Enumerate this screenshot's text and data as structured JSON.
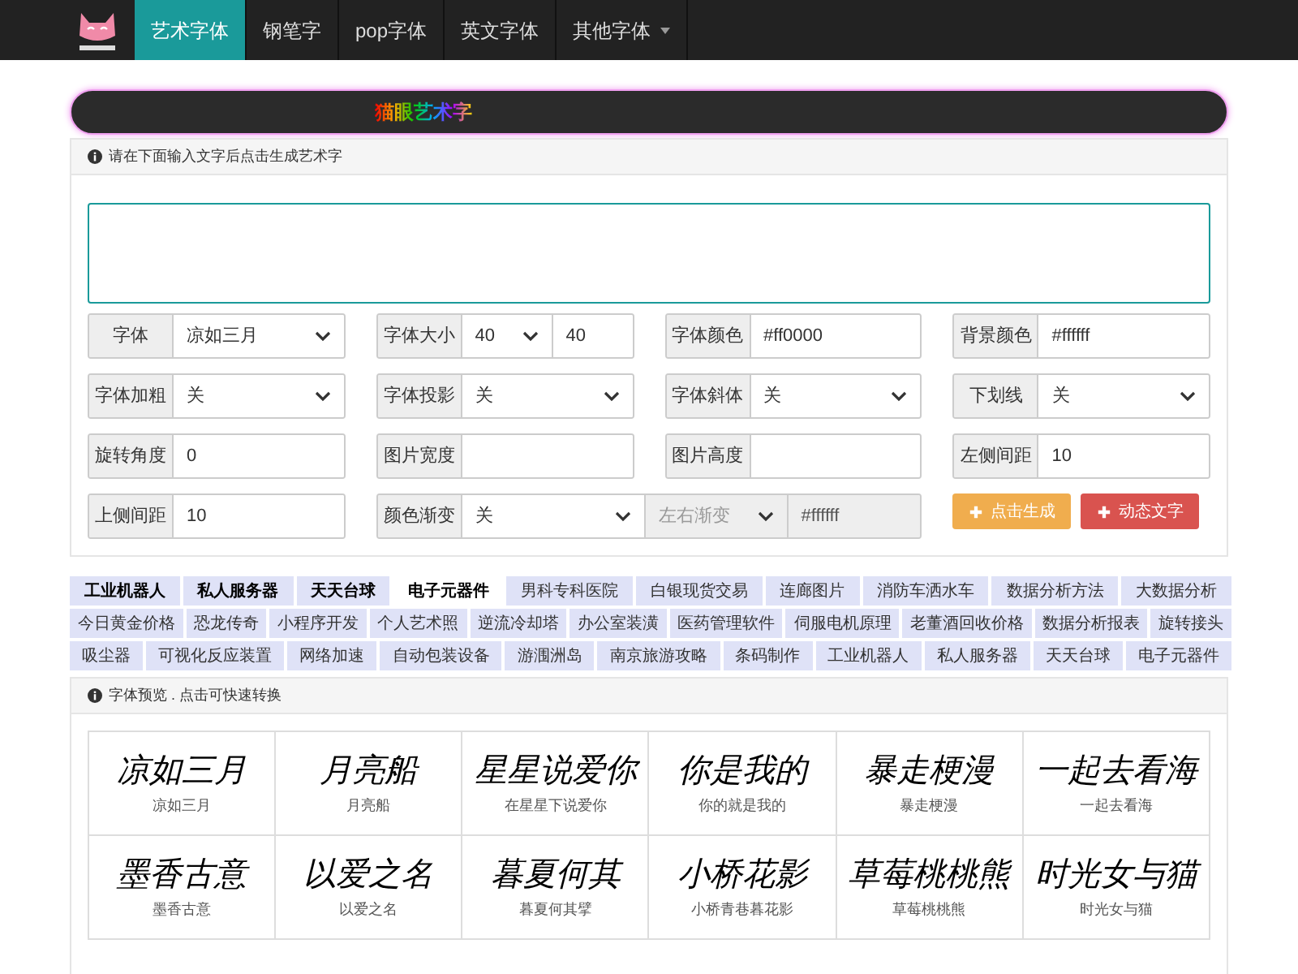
{
  "nav": {
    "items": [
      {
        "label": "艺术字体",
        "selected": true,
        "dropdown": false
      },
      {
        "label": "钢笔字",
        "selected": false,
        "dropdown": false
      },
      {
        "label": "pop字体",
        "selected": false,
        "dropdown": false
      },
      {
        "label": "英文字体",
        "selected": false,
        "dropdown": false
      },
      {
        "label": "其他字体",
        "selected": false,
        "dropdown": true
      }
    ]
  },
  "banner": {
    "title": "猫眼艺术字"
  },
  "form_panel": {
    "hint": "请在下面输入文字后点击生成艺术字",
    "fields": [
      {
        "kind": "select",
        "label": "字体",
        "value": "凉如三月"
      },
      {
        "kind": "size",
        "label": "字体大小",
        "value": "40",
        "value2": "40"
      },
      {
        "kind": "input",
        "label": "字体颜色",
        "value": "#ff0000"
      },
      {
        "kind": "input",
        "label": "背景颜色",
        "value": "#ffffff"
      },
      {
        "kind": "select",
        "label": "字体加粗",
        "value": "关"
      },
      {
        "kind": "select",
        "label": "字体投影",
        "value": "关"
      },
      {
        "kind": "select",
        "label": "字体斜体",
        "value": "关"
      },
      {
        "kind": "select",
        "label": "下划线",
        "value": "关"
      },
      {
        "kind": "input",
        "label": "旋转角度",
        "value": "0"
      },
      {
        "kind": "input",
        "label": "图片宽度"
      },
      {
        "kind": "input",
        "label": "图片高度"
      },
      {
        "kind": "input",
        "label": "左侧间距",
        "value": "10"
      },
      {
        "kind": "input",
        "label": "上侧间距",
        "value": "10"
      },
      {
        "kind": "gradient",
        "label": "颜色渐变",
        "value": "关",
        "direction": "左右渐变",
        "end_value": "#ffffff",
        "disabled": true
      },
      {
        "kind": "buttons",
        "buttons": [
          {
            "label": "点击生成",
            "kind": "warning"
          },
          {
            "label": "动态文字",
            "kind": "danger"
          }
        ]
      }
    ]
  },
  "tag_rows": [
    [
      {
        "label": "工业机器人",
        "bold": true,
        "selected": false
      },
      {
        "label": "私人服务器",
        "bold": true,
        "selected": false
      },
      {
        "label": "天天台球",
        "bold": true,
        "selected": false
      },
      {
        "label": "电子元器件",
        "bold": true,
        "selected": true
      },
      {
        "label": "男科专科医院",
        "bold": false,
        "selected": false
      },
      {
        "label": "白银现货交易",
        "bold": false,
        "selected": false
      },
      {
        "label": "连廊图片",
        "bold": false,
        "selected": false
      },
      {
        "label": "消防车洒水车",
        "bold": false,
        "selected": false
      },
      {
        "label": "数据分析方法",
        "bold": false,
        "selected": false
      },
      {
        "label": "大数据分析",
        "bold": false,
        "selected": false
      }
    ],
    [
      {
        "label": "今日黄金价格",
        "bold": false,
        "selected": false
      },
      {
        "label": "恐龙传奇",
        "bold": false,
        "selected": false
      },
      {
        "label": "小程序开发",
        "bold": false,
        "selected": false
      },
      {
        "label": "个人艺术照",
        "bold": false,
        "selected": false
      },
      {
        "label": "逆流冷却塔",
        "bold": false,
        "selected": false
      },
      {
        "label": "办公室装潢",
        "bold": false,
        "selected": false
      },
      {
        "label": "医药管理软件",
        "bold": false,
        "selected": false
      },
      {
        "label": "伺服电机原理",
        "bold": false,
        "selected": false
      },
      {
        "label": "老董酒回收价格",
        "bold": false,
        "selected": false
      },
      {
        "label": "数据分析报表",
        "bold": false,
        "selected": false
      },
      {
        "label": "旋转接头",
        "bold": false,
        "selected": false
      }
    ],
    [
      {
        "label": "吸尘器",
        "bold": false,
        "selected": false
      },
      {
        "label": "可视化反应装置",
        "bold": false,
        "selected": false
      },
      {
        "label": "网络加速",
        "bold": false,
        "selected": false
      },
      {
        "label": "自动包装设备",
        "bold": false,
        "selected": false
      },
      {
        "label": "游涠洲岛",
        "bold": false,
        "selected": false
      },
      {
        "label": "南京旅游攻略",
        "bold": false,
        "selected": false
      },
      {
        "label": "条码制作",
        "bold": false,
        "selected": false
      },
      {
        "label": "工业机器人",
        "bold": false,
        "selected": false
      },
      {
        "label": "私人服务器",
        "bold": false,
        "selected": false
      },
      {
        "label": "天天台球",
        "bold": false,
        "selected": false
      },
      {
        "label": "电子元器件",
        "bold": false,
        "selected": false
      }
    ]
  ],
  "preview_panel": {
    "hint": "字体预览 . 点击可快速转换",
    "fonts": [
      {
        "sample": "凉如三月",
        "label": "凉如三月"
      },
      {
        "sample": "月亮船",
        "label": "月亮船"
      },
      {
        "sample": "星星说爱你",
        "label": "在星星下说爱你"
      },
      {
        "sample": "你是我的",
        "label": "你的就是我的"
      },
      {
        "sample": "暴走梗漫",
        "label": "暴走梗漫"
      },
      {
        "sample": "一起去看海",
        "label": "一起去看海"
      },
      {
        "sample": "墨香古意",
        "label": "墨香古意"
      },
      {
        "sample": "以爱之名",
        "label": "以爱之名"
      },
      {
        "sample": "暮夏何其",
        "label": "暮夏何其擘"
      },
      {
        "sample": "小桥花影",
        "label": "小桥青巷暮花影"
      },
      {
        "sample": "草莓桃桃熊",
        "label": "草莓桃桃熊"
      },
      {
        "sample": "时光女与猫",
        "label": "时光女与猫"
      }
    ]
  }
}
